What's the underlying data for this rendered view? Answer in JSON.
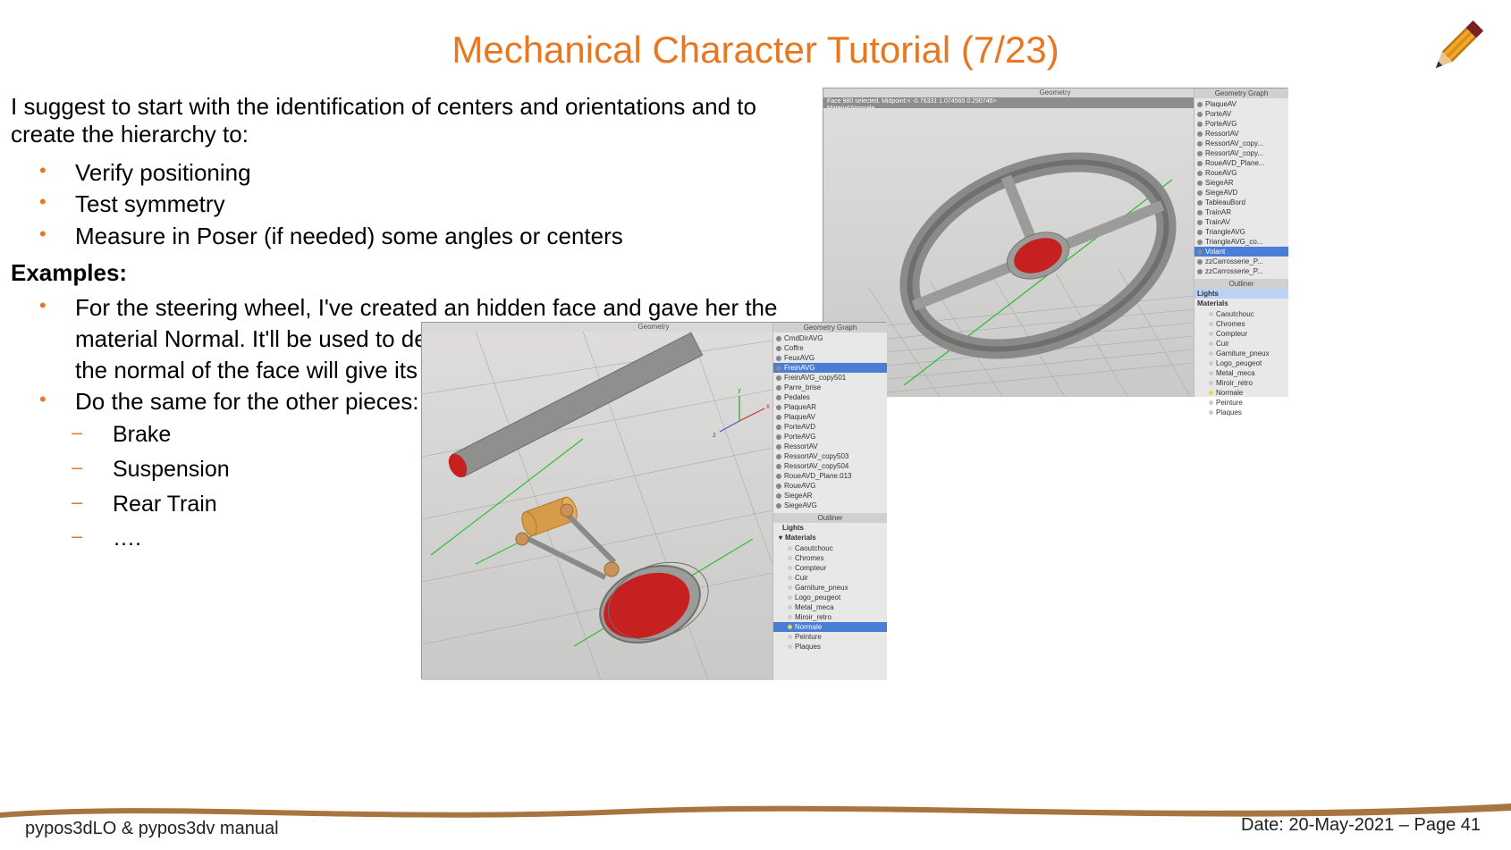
{
  "title": "Mechanical Character Tutorial (7/23)",
  "intro": "I suggest to start with the identification of centers and orientations and to create the hierarchy to:",
  "bullets": [
    "Verify positioning",
    "Test symmetry",
    "Measure in Poser (if needed) some angles or centers"
  ],
  "examples_heading": "Examples:",
  "examples": [
    "For the steering wheel, I've created an hidden face and gave her the material Normal. It'll be used to defined the center of the piece and the normal of the face will give its orientation.",
    "Do the same for the other pieces:"
  ],
  "pieces": [
    "Brake",
    "Suspension",
    "Rear Train",
    "…."
  ],
  "shot1": {
    "geometry_label": "Geometry",
    "graph_label": "Geometry Graph",
    "info_line1": "Face 980 selected. Midpoint:< -0.76331  1.074565  0.290746>",
    "info_line2": "Material:Normale.",
    "outliner_label": "Outliner",
    "lights_label": "Lights",
    "materials_label": "Materials",
    "items": [
      "PlaqueAV",
      "PorteAV",
      "PorteAVG",
      "RessortAV",
      "RessortAV_copy...",
      "RessortAV_copy...",
      "RoueAVD_Plane...",
      "RoueAVG",
      "SiegeAR",
      "SiegeAVD",
      "TableauBord",
      "TrainAR",
      "TrainAV",
      "TriangleAVG",
      "TriangleAVG_co...",
      "Volant",
      "zzCarrosserie_P...",
      "zzCarrosserie_P..."
    ],
    "selected": "Volant",
    "materials": [
      "Caoutchouc",
      "Chromes",
      "Compteur",
      "Cuir",
      "Garniture_pneux",
      "Logo_peugeot",
      "Metal_meca",
      "Miroir_retro",
      "Normale",
      "Peinture",
      "Plaques"
    ]
  },
  "shot2": {
    "geometry_label": "Geometry",
    "graph_label": "Geometry Graph",
    "outliner_label": "Outliner",
    "lights_label": "Lights",
    "materials_label": "Materials",
    "items": [
      "CmdDirAVG",
      "Coffre",
      "FeuxAVG",
      "FreinAVG",
      "FreinAVG_copy501",
      "Parre_brise",
      "Pedales",
      "PlaqueAR",
      "PlaqueAV",
      "PorteAVD",
      "PorteAVG",
      "RessortAV",
      "RessortAV_copy503",
      "RessortAV_copy504",
      "RoueAVD_Plane.013",
      "RoueAVG",
      "SiegeAR",
      "SiegeAVG"
    ],
    "selected": "FreinAVG",
    "materials": [
      "Caoutchouc",
      "Chromes",
      "Compteur",
      "Cuir",
      "Garniture_pneux",
      "Logo_peugeot",
      "Metal_meca",
      "Miroir_retro",
      "Normale",
      "Peinture",
      "Plaques"
    ]
  },
  "footer": {
    "left": "pypos3dLO & pypos3dv manual",
    "right": "Date: 20-May-2021 – Page 41"
  }
}
